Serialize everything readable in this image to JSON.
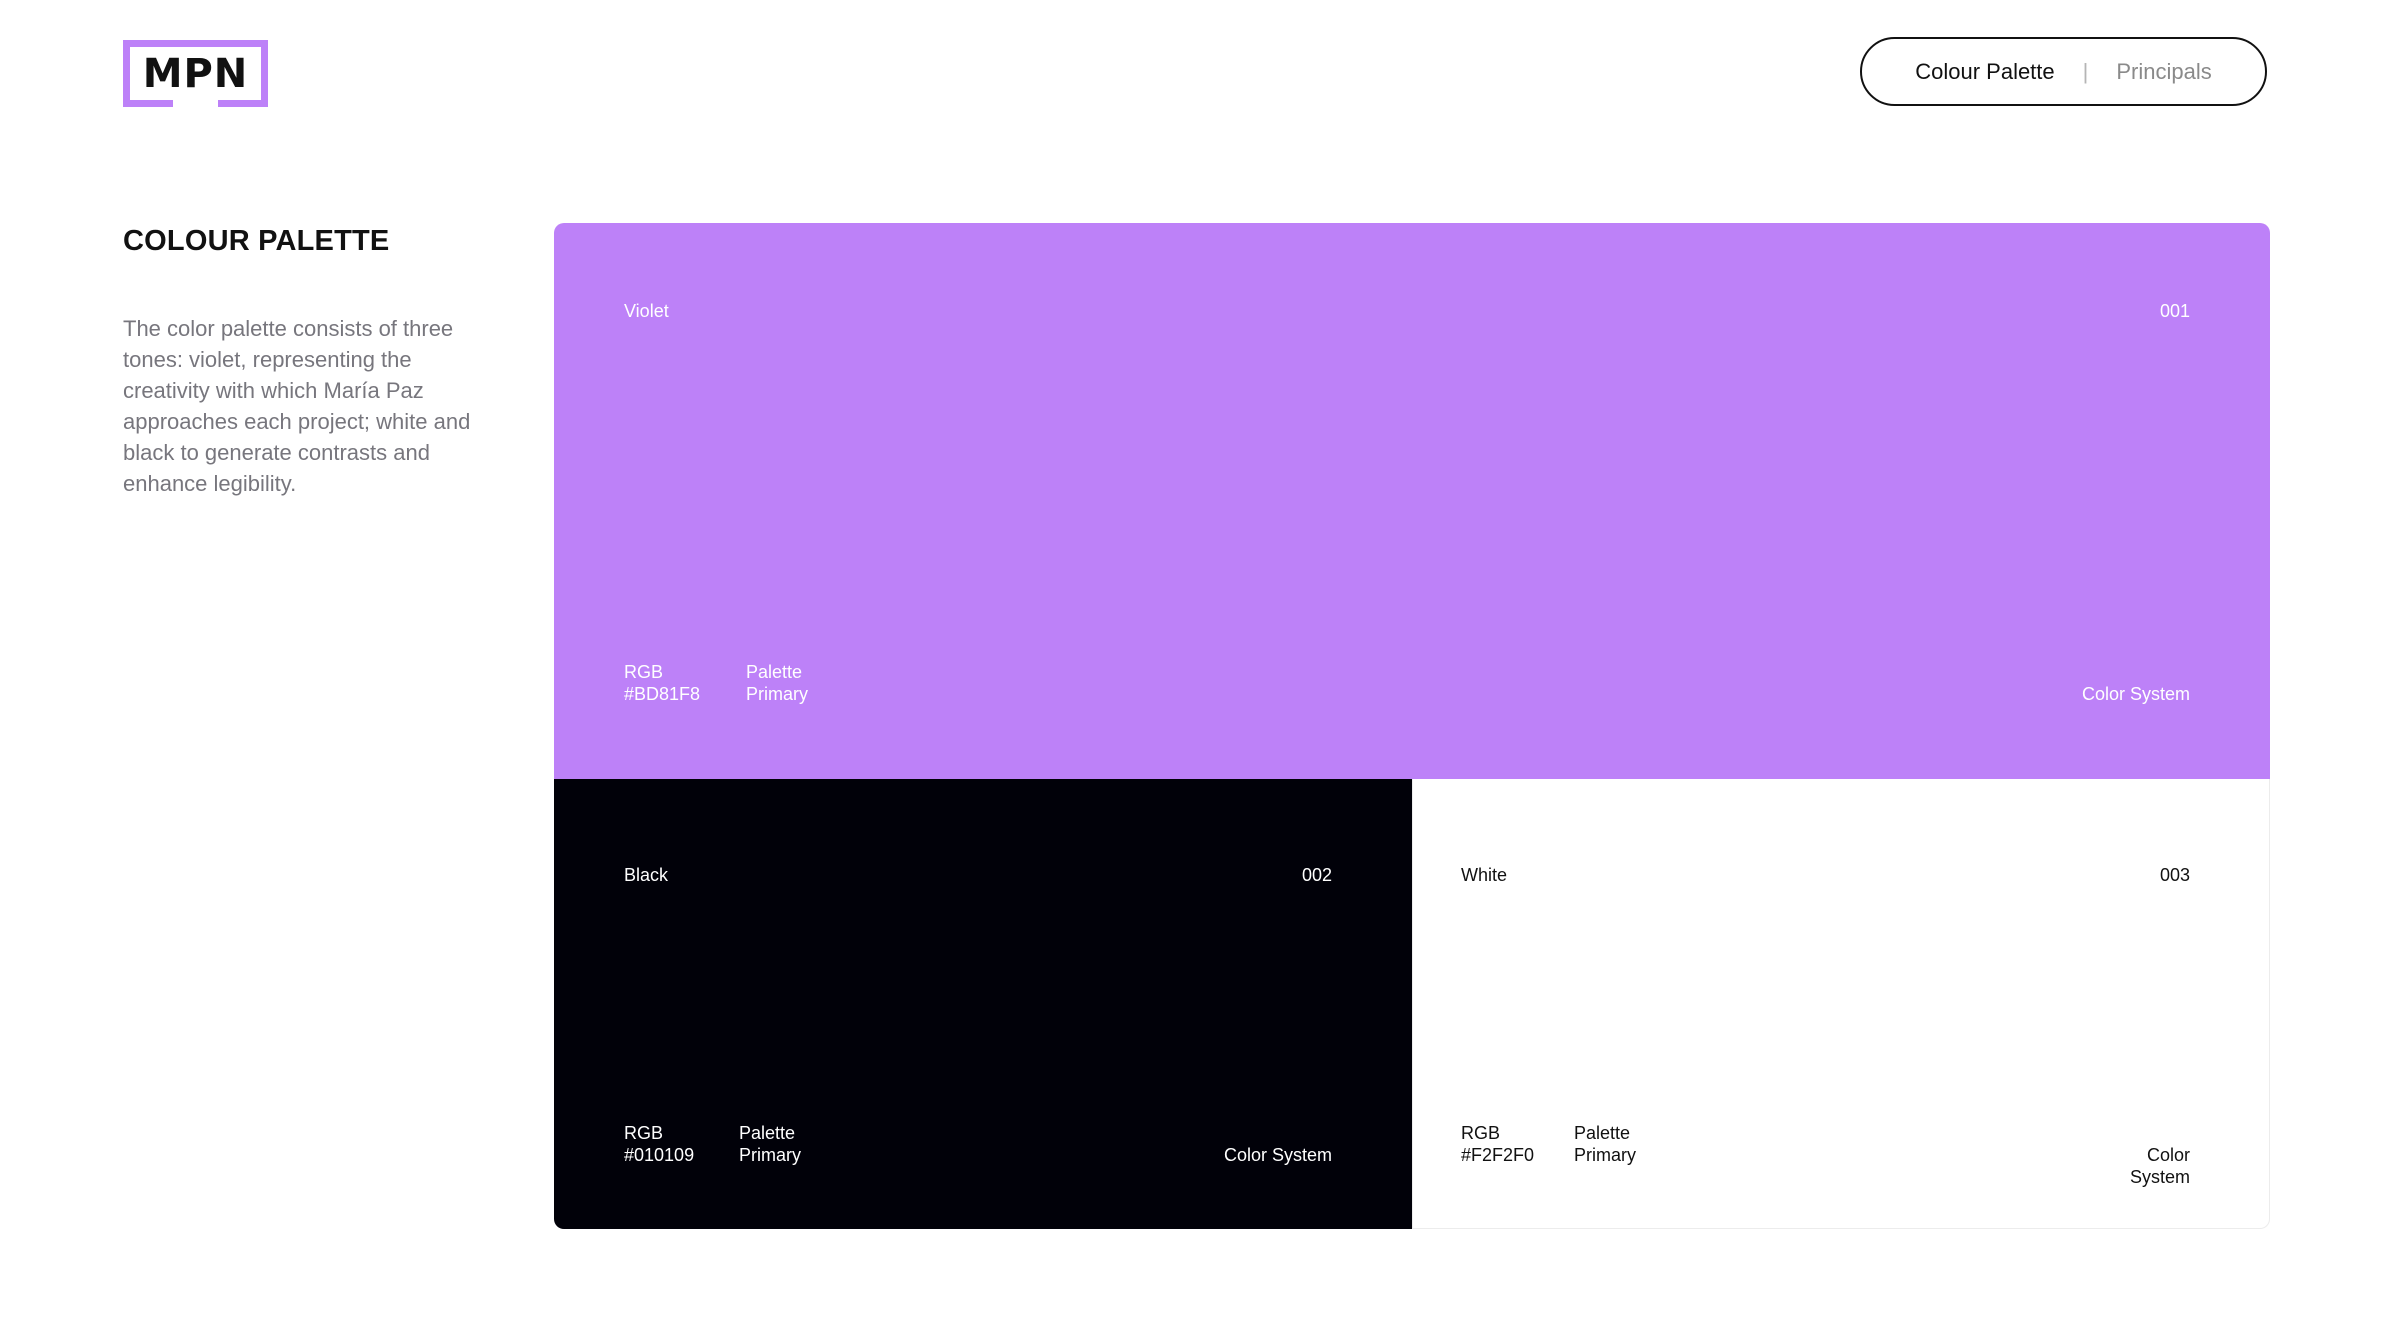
{
  "logo": {
    "text": "MPN",
    "accent": "#BD81F8"
  },
  "nav": {
    "items": [
      "Colour Palette",
      "Principals"
    ],
    "active_index": 0,
    "separator": "|"
  },
  "section": {
    "title": "COLOUR PALETTE",
    "description": "The color palette consists of three tones: violet, representing the creativity with which María Paz approaches each project; white and black to generate contrasts and enhance legibility."
  },
  "swatches": {
    "violet": {
      "name": "Violet",
      "number": "001",
      "code": "RGB\n#BD81F8",
      "palette": "Palette\nPrimary",
      "system": "Color System",
      "color": "#BD81F8"
    },
    "black": {
      "name": "Black",
      "number": "002",
      "code": "RGB\n#010109",
      "palette": "Palette\nPrimary",
      "system": "Color System",
      "color": "#010109"
    },
    "white": {
      "name": "White",
      "number": "003",
      "code": "RGB\n#F2F2F0",
      "palette": "Palette\nPrimary",
      "system": "Color\nSystem",
      "color": "#F2F2F0"
    }
  }
}
